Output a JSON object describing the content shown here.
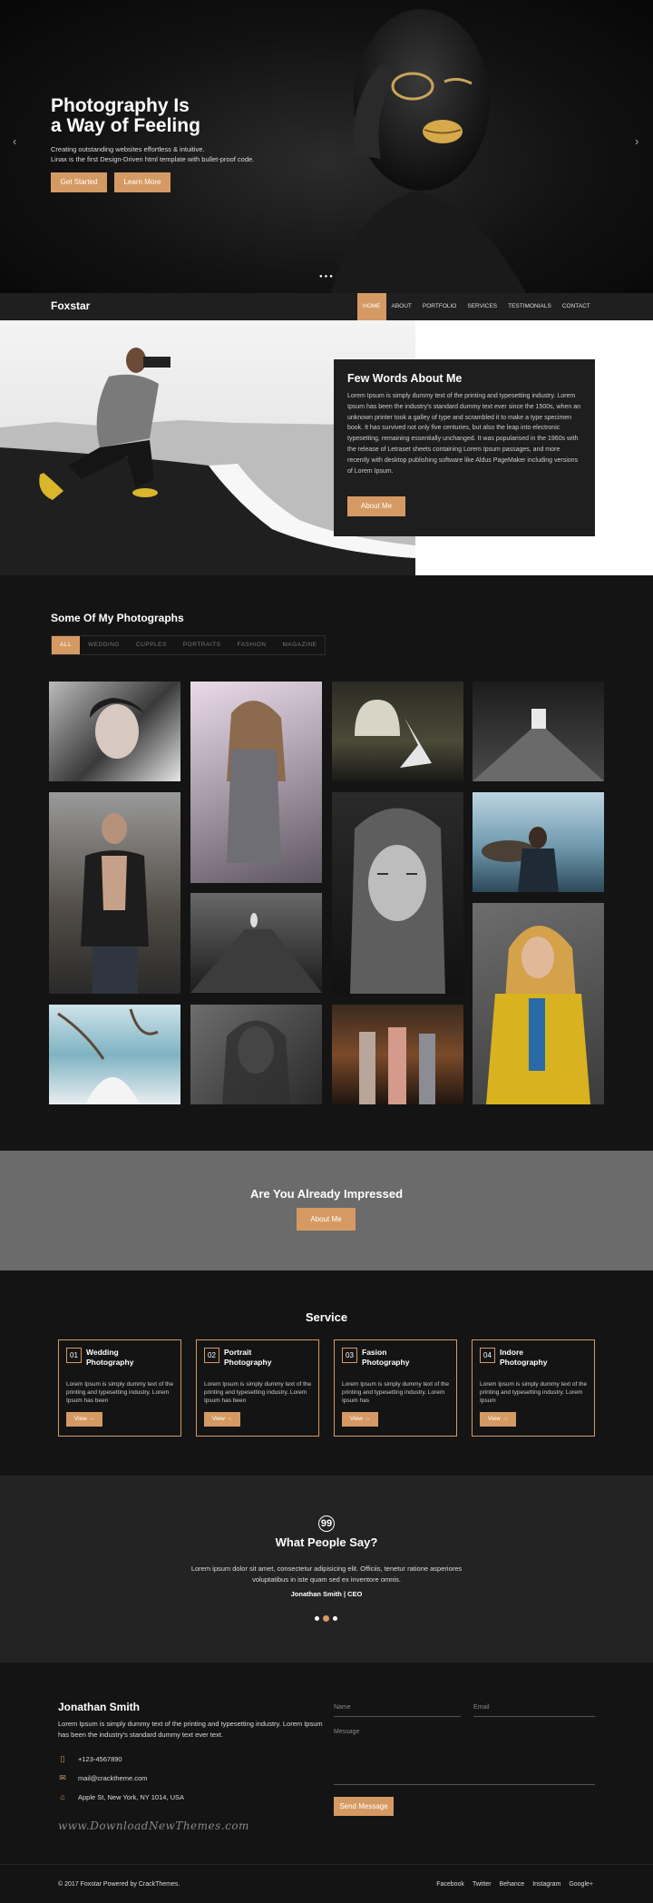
{
  "hero": {
    "title_line1": "Photography Is",
    "title_line2": "a Way of Feeling",
    "subtitle_line1": "Creating outstanding websites effortless & intuitive.",
    "subtitle_line2": "Linax is the first Design-Driven html template with bullet-proof code.",
    "primary_button": "Get Started",
    "secondary_button": "Learn More",
    "prev_arrow": "‹",
    "next_arrow": "›",
    "slider_dots": "●●●"
  },
  "nav": {
    "logo": "Foxstar",
    "items": [
      "HOME",
      "ABOUT",
      "PORTFOLIO",
      "SERVICES",
      "TESTIMONIALS",
      "CONTACT"
    ],
    "active": "HOME"
  },
  "about": {
    "title": "Few Words About Me",
    "body": "Lorem Ipsum is simply dummy text of the printing and typesetting industry. Lorem Ipsum has been the industry's standard dummy text ever since the 1500s, when an unknown printer took a galley of type and scrambled it to make a type specimen book. It has survived not only five centuries, but also the leap into electronic typesetting, remaining essentially unchanged. It was popularised in the 1960s with the release of Letraset sheets containing Lorem Ipsum passages, and more recently with desktop publishing software like Aldus PageMaker including versions of Lorem Ipsum.",
    "button": "About Me"
  },
  "gallery": {
    "title": "Some Of My Photographs",
    "filters": [
      "ALL",
      "WEDDING",
      "CUPPLES",
      "PORTRAITS",
      "FASHION",
      "MAGAZINE"
    ],
    "active_filter": "ALL"
  },
  "impressed": {
    "title": "Are You Already Impressed",
    "button": "About Me"
  },
  "service": {
    "title": "Service",
    "cards": [
      {
        "num": "01",
        "title_line1": "Wedding",
        "title_line2": "Photography",
        "text": "Lorem Ipsum is simply dummy text of the printing and typesetting industry. Lorem Ipsum has been",
        "button": "View →"
      },
      {
        "num": "02",
        "title_line1": "Portrait",
        "title_line2": "Photography",
        "text": "Lorem Ipsum is simply dummy text of the printing and typesetting industry. Lorem Ipsum has been",
        "button": "View →"
      },
      {
        "num": "03",
        "title_line1": "Fasion",
        "title_line2": "Photography",
        "text": "Lorem Ipsum is simply dummy text of the printing and typesetting industry. Lorem Ipsum has",
        "button": "View →"
      },
      {
        "num": "04",
        "title_line1": "Indore",
        "title_line2": "Photography",
        "text": "Lorem Ipsum is simply dummy text of the printing and typesetting industry. Lorem Ipsum",
        "button": "View →"
      }
    ]
  },
  "testimonial": {
    "quote_glyph": "99",
    "title": "What People Say?",
    "text": "Lorem ipsum dolor sit amet, consectetur adipisicing elit. Officiis, tenetur ratione asperiores voluptatibus in iste quam sed ex inventore omnis.",
    "author": "Jonathan Smith | CEO"
  },
  "contact": {
    "name": "Jonathan Smith",
    "description": "Lorem Ipsum is simply dummy text of the printing and typesetting industry. Lorem Ipsum has been the industry's standard dummy text ever text.",
    "phone": "+123-4567890",
    "email": "mail@cracktheme.com",
    "address": "Apple St, New York, NY 1014, USA",
    "name_placeholder": "Name",
    "email_placeholder": "Email",
    "message_placeholder": "Message",
    "send_button": "Send Message",
    "watermark": "www.DownloadNewThemes.com"
  },
  "footer": {
    "copyright": "© 2017 Foxstar Powered by CrackThemes.",
    "social": [
      "Facebook",
      "Twitter",
      "Behance",
      "Instagram",
      "Google+"
    ]
  },
  "colors": {
    "accent": "#d59a63",
    "dark": "#141414",
    "panel": "#1e1e1e",
    "gray_band": "#6b6b6b"
  }
}
